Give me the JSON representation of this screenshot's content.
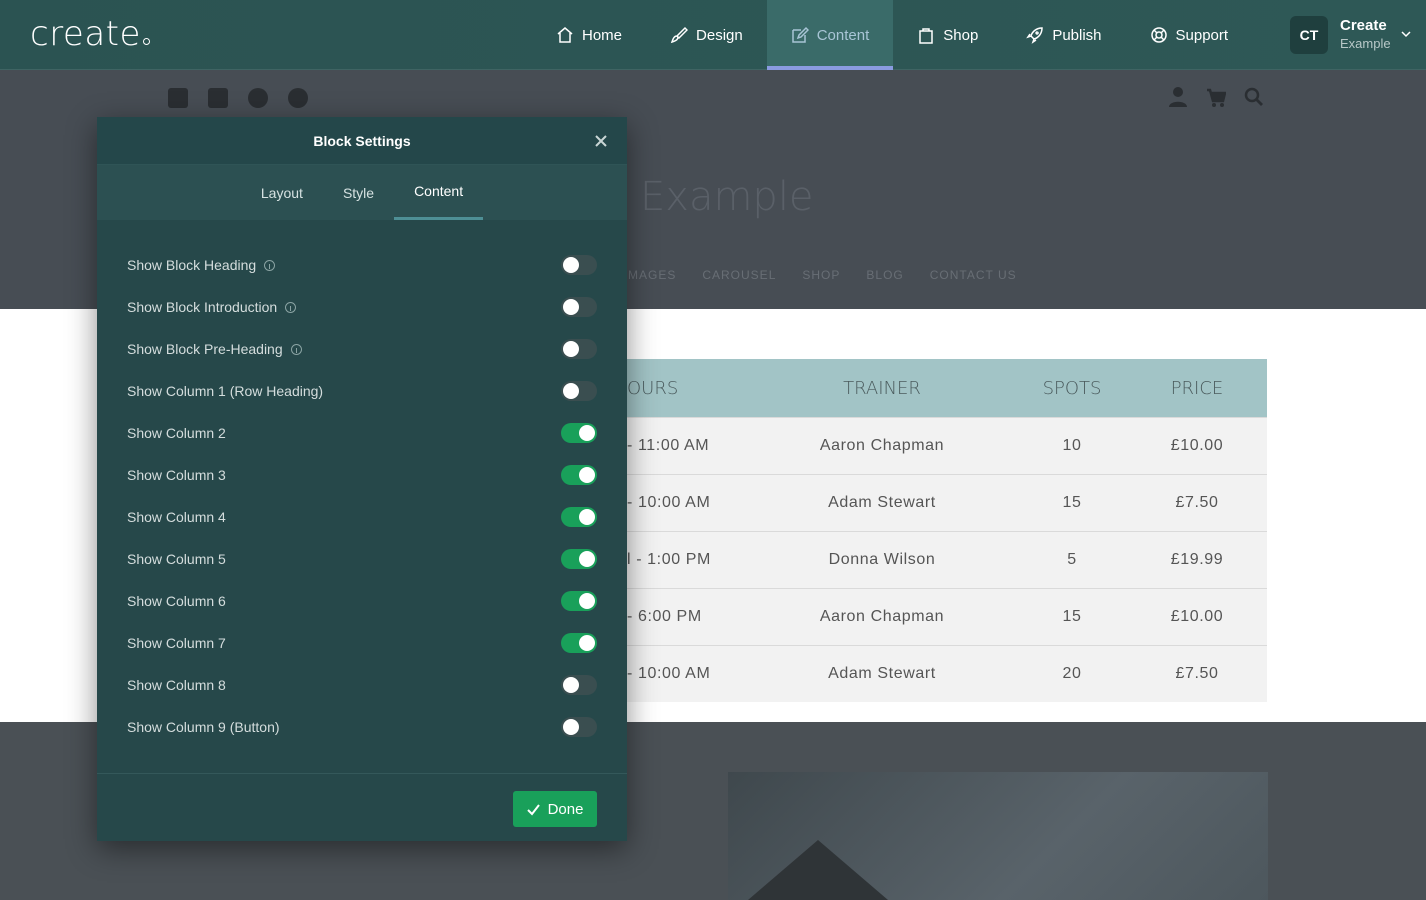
{
  "topbar": {
    "logo": "create",
    "nav": [
      {
        "label": "Home",
        "icon": "home-icon"
      },
      {
        "label": "Design",
        "icon": "brush-icon"
      },
      {
        "label": "Content",
        "icon": "edit-icon",
        "active": true
      },
      {
        "label": "Shop",
        "icon": "bag-icon"
      },
      {
        "label": "Publish",
        "icon": "rocket-icon"
      },
      {
        "label": "Support",
        "icon": "lifebuoy-icon"
      }
    ],
    "account": {
      "initials": "CT",
      "name": "Create",
      "site": "Example"
    }
  },
  "site": {
    "title": "Example",
    "nav": [
      "MAGES",
      "CAROUSEL",
      "SHOP",
      "BLOG",
      "CONTACT US"
    ],
    "table": {
      "headers": [
        "OURS",
        "TRAINER",
        "SPOTS",
        "PRICE"
      ],
      "rows": [
        [
          "- 11:00 AM",
          "Aaron Chapman",
          "10",
          "£10.00"
        ],
        [
          "- 10:00 AM",
          "Adam Stewart",
          "15",
          "£7.50"
        ],
        [
          "l - 1:00 PM",
          "Donna Wilson",
          "5",
          "£19.99"
        ],
        [
          "- 6:00 PM",
          "Aaron Chapman",
          "15",
          "£10.00"
        ],
        [
          "- 10:00 AM",
          "Adam Stewart",
          "20",
          "£7.50"
        ]
      ]
    }
  },
  "modal": {
    "title": "Block Settings",
    "tabs": [
      "Layout",
      "Style",
      "Content"
    ],
    "active_tab": "Content",
    "settings": [
      {
        "label": "Show Block Heading",
        "info": true,
        "on": false
      },
      {
        "label": "Show Block Introduction",
        "info": true,
        "on": false
      },
      {
        "label": "Show Block Pre-Heading",
        "info": true,
        "on": false
      },
      {
        "label": "Show Column 1 (Row Heading)",
        "info": false,
        "on": false
      },
      {
        "label": "Show Column 2",
        "info": false,
        "on": true
      },
      {
        "label": "Show Column 3",
        "info": false,
        "on": true
      },
      {
        "label": "Show Column 4",
        "info": false,
        "on": true
      },
      {
        "label": "Show Column 5",
        "info": false,
        "on": true
      },
      {
        "label": "Show Column 6",
        "info": false,
        "on": true
      },
      {
        "label": "Show Column 7",
        "info": false,
        "on": true
      },
      {
        "label": "Show Column 8",
        "info": false,
        "on": false
      },
      {
        "label": "Show Column 9 (Button)",
        "info": false,
        "on": false
      }
    ],
    "done_label": "Done"
  },
  "colors": {
    "accent": "#19a05a",
    "topbar": "#2b5352",
    "modal": "#26484a",
    "active_tab_underline": "#8a9be0"
  }
}
